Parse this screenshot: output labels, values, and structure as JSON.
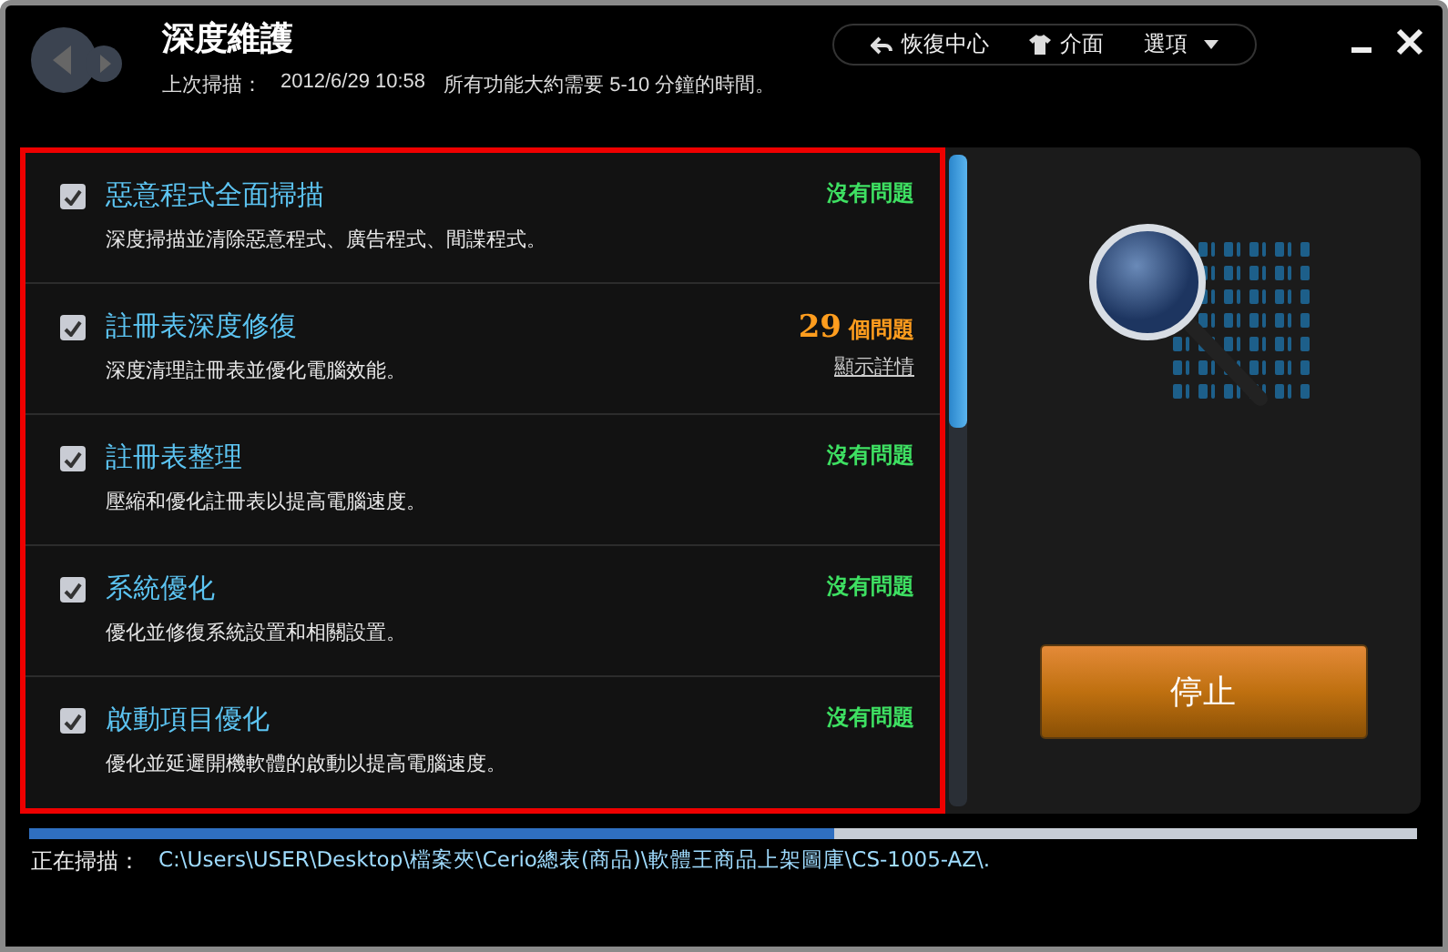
{
  "window": {
    "title": "深度維護",
    "last_scan_label": "上次掃描：",
    "last_scan_time": "2012/6/29 10:58",
    "duration_note": "所有功能大約需要 5-10 分鐘的時間。"
  },
  "top_menu": [
    {
      "label": "恢復中心",
      "kind": "back"
    },
    {
      "label": "介面",
      "kind": "shirt"
    },
    {
      "label": "選項",
      "kind": "dropdown"
    }
  ],
  "tasks": [
    {
      "title": "惡意程式全面掃描",
      "description": "深度掃描並清除惡意程式、廣告程式、間諜程式。",
      "checked": true,
      "kind": "ok",
      "status": "沒有問題"
    },
    {
      "title": "註冊表深度修復",
      "description": "深度清理註冊表並優化電腦效能。",
      "checked": true,
      "kind": "issues",
      "count": "29",
      "status": "個問題",
      "link": "顯示詳情"
    },
    {
      "title": "註冊表整理",
      "description": "壓縮和優化註冊表以提高電腦速度。",
      "checked": true,
      "kind": "ok",
      "status": "沒有問題"
    },
    {
      "title": "系統優化",
      "description": "優化並修復系統設置和相關設置。",
      "checked": true,
      "kind": "ok",
      "status": "沒有問題"
    },
    {
      "title": "啟動項目優化",
      "description": "優化並延遲開機軟體的啟動以提高電腦速度。",
      "checked": true,
      "kind": "ok",
      "status": "沒有問題"
    }
  ],
  "stop_button": "停止",
  "progress": {
    "level": 0.58
  },
  "scan": {
    "label": "正在掃描：",
    "path": "C:\\Users\\USER\\Desktop\\檔案夾\\Cerio總表(商品)\\軟體王商品上架圖庫\\CS-1005-AZ\\."
  }
}
